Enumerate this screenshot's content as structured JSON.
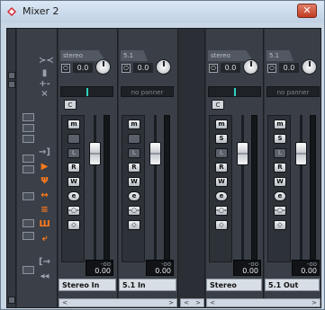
{
  "window": {
    "title": "Mixer 2",
    "close_label": "✕"
  },
  "left_rail": {
    "expand_label": "⌄"
  },
  "channels_left": [
    {
      "route": "stereo",
      "gain": "0.0",
      "pan": "",
      "pan_tab": "C",
      "buttons": [
        "m",
        "",
        "L",
        "R",
        "W",
        "e"
      ],
      "db_top": "-oo",
      "db_main": "0.00",
      "name": "Stereo In"
    },
    {
      "route": "5.1",
      "gain": "0.0",
      "pan": "no panner",
      "pan_tab": "",
      "buttons": [
        "m",
        "",
        "L",
        "R",
        "W",
        "e"
      ],
      "db_top": "-oo",
      "db_main": "0.00",
      "name": "5.1 In"
    }
  ],
  "channels_right": [
    {
      "route": "stereo",
      "gain": "0.0",
      "pan": "",
      "pan_tab": "C",
      "buttons": [
        "m",
        "S",
        "L",
        "R",
        "W",
        "e"
      ],
      "db_top": "-oo",
      "db_main": "0.00",
      "name": "Stereo"
    },
    {
      "route": "5.1",
      "gain": "0.0",
      "pan": "no panner",
      "pan_tab": "",
      "buttons": [
        "m",
        "S",
        "L",
        "R",
        "W",
        "e"
      ],
      "db_top": "-oo",
      "db_main": "0.00",
      "name": "5.1 Out"
    }
  ],
  "scroll": {
    "left": "<",
    "right": ">"
  }
}
